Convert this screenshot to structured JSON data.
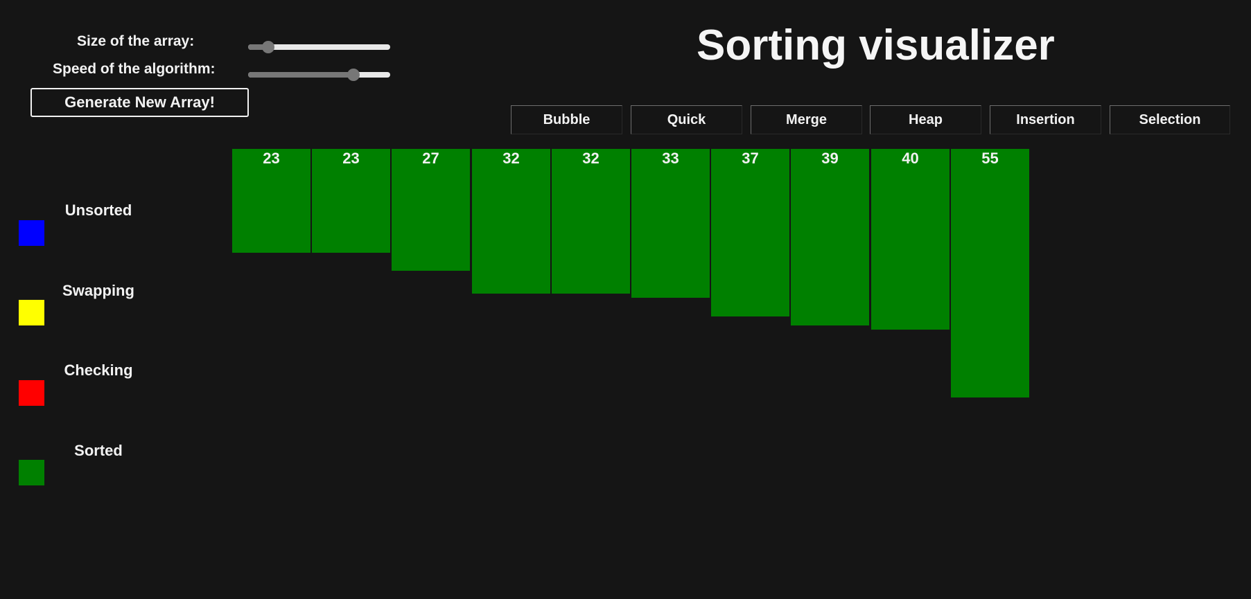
{
  "controls": {
    "size_label": "Size of the array:",
    "speed_label": "Speed of the algorithm:",
    "size_value": 0.14,
    "speed_value": 0.74,
    "generate_label": "Generate New Array!"
  },
  "title": "Sorting visualizer",
  "algorithms": [
    "Bubble",
    "Quick",
    "Merge",
    "Heap",
    "Insertion",
    "Selection"
  ],
  "legend": [
    {
      "label": "Unsorted",
      "color": "#0000ff"
    },
    {
      "label": "Swapping",
      "color": "#ffff00"
    },
    {
      "label": "Checking",
      "color": "#ff0000"
    },
    {
      "label": "Sorted",
      "color": "#008000"
    }
  ],
  "chart_data": {
    "type": "bar",
    "values": [
      23,
      23,
      27,
      32,
      32,
      33,
      37,
      39,
      40,
      55
    ],
    "state": "sorted",
    "bar_color": "#008000"
  }
}
